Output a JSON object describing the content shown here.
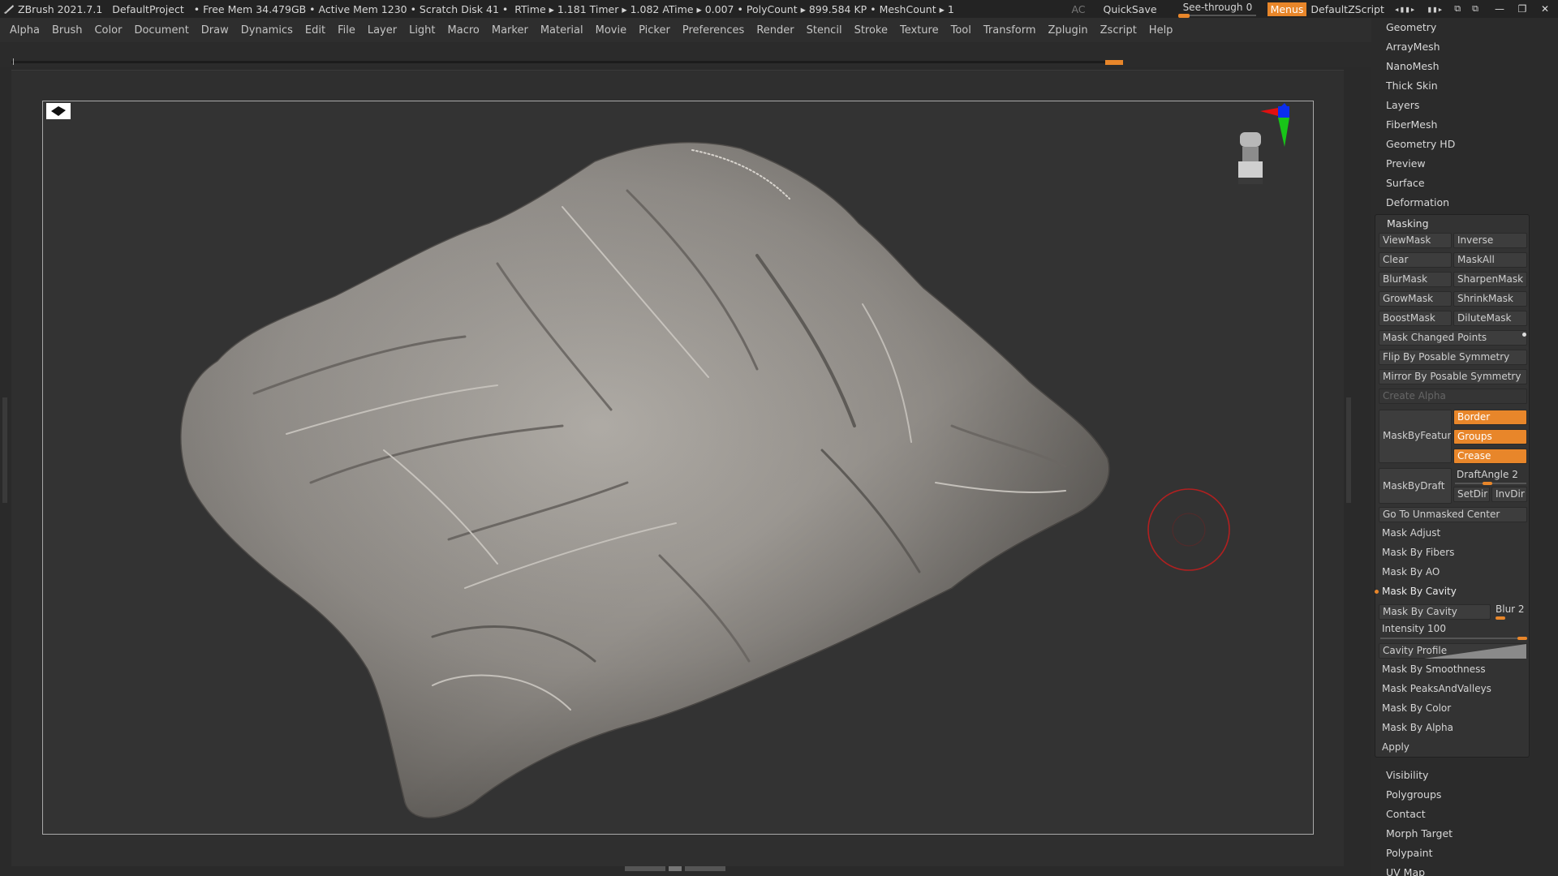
{
  "titlebar": {
    "app": "ZBrush 2021.7.1",
    "project": "DefaultProject",
    "stats": "• Free Mem 34.479GB • Active Mem 1230 • Scratch Disk 41 •",
    "timers": "RTime ▸ 1.181 Timer ▸ 1.082 ATime ▸ 0.007",
    "polycount": "• PolyCount ▸ 899.584 KP",
    "meshcount": "• MeshCount ▸ 1",
    "ac": "AC",
    "quicksave": "QuickSave",
    "see_through_label": "See-through",
    "see_through_value": "0",
    "menus": "Menus",
    "default_zscript": "DefaultZScript"
  },
  "menubar": [
    "Alpha",
    "Brush",
    "Color",
    "Document",
    "Draw",
    "Dynamics",
    "Edit",
    "File",
    "Layer",
    "Light",
    "Macro",
    "Marker",
    "Material",
    "Movie",
    "Picker",
    "Preferences",
    "Render",
    "Stencil",
    "Stroke",
    "Texture",
    "Tool",
    "Transform",
    "Zplugin",
    "Zscript",
    "Help"
  ],
  "panel": {
    "top_items": [
      "Geometry",
      "ArrayMesh",
      "NanoMesh",
      "Thick Skin",
      "Layers",
      "FiberMesh",
      "Geometry HD",
      "Preview",
      "Surface",
      "Deformation"
    ],
    "masking": {
      "title": "Masking",
      "view_mask": "ViewMask",
      "inverse": "Inverse",
      "clear": "Clear",
      "mask_all": "MaskAll",
      "blur_mask": "BlurMask",
      "sharpen_mask": "SharpenMask",
      "grow_mask": "GrowMask",
      "shrink_mask": "ShrinkMask",
      "boost_mask": "BoostMask",
      "dilute_mask": "DiluteMask",
      "mask_changed_points": "Mask Changed Points",
      "flip_by_posable_symmetry": "Flip By Posable Symmetry",
      "mirror_by_posable_symmetry": "Mirror By Posable Symmetry",
      "create_alpha": "Create Alpha",
      "mask_by_feature": "MaskByFeature",
      "border": "Border",
      "groups": "Groups",
      "crease": "Crease",
      "mask_by_draft": "MaskByDraft",
      "draft_angle_label": "DraftAngle 2",
      "setdir": "SetDir",
      "invdir": "InvDir",
      "go_to_unmasked_center": "Go To Unmasked Center",
      "mask_adjust": "Mask Adjust",
      "mask_by_fibers": "Mask By Fibers",
      "mask_by_ao": "Mask By AO",
      "mask_by_cavity_header": "Mask By Cavity",
      "mask_by_cavity_btn": "Mask By Cavity",
      "blur_label": "Blur 2",
      "intensity_label": "Intensity 100",
      "cavity_profile": "Cavity Profile",
      "mask_by_smoothness": "Mask By Smoothness",
      "mask_peaks_and_valleys": "Mask PeaksAndValleys",
      "mask_by_color": "Mask By Color",
      "mask_by_alpha": "Mask By Alpha",
      "apply": "Apply"
    },
    "bottom_items": [
      "Visibility",
      "Polygroups",
      "Contact",
      "Morph Target",
      "Polypaint",
      "UV Map"
    ]
  },
  "colors": {
    "accent": "#e8862a",
    "background": "#2a2a2a",
    "brush_cursor": "#b02020"
  },
  "icons": [
    "zbrush-logo-icon",
    "document-icon",
    "gizmo-icon",
    "brush-cursor-icon"
  ]
}
